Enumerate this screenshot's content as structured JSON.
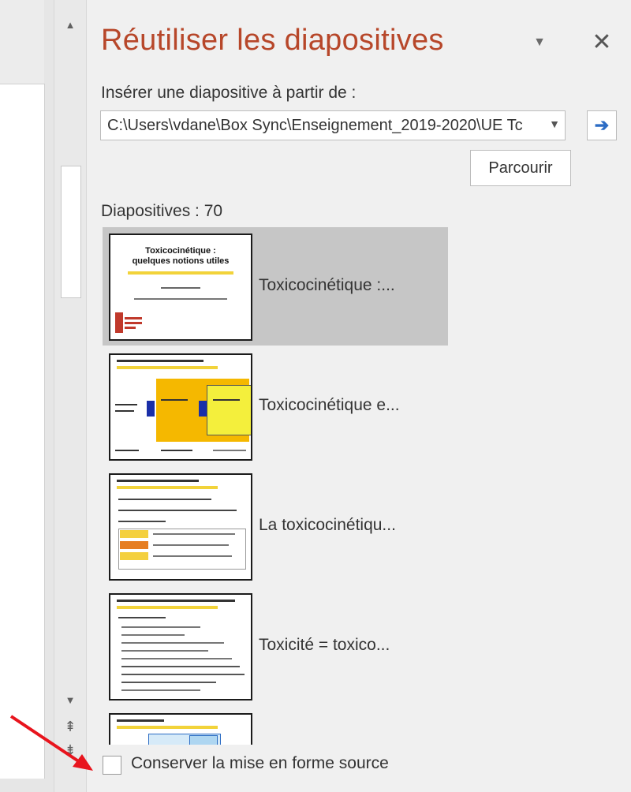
{
  "pane": {
    "title": "Réutiliser les diapositives",
    "insert_label": "Insérer une diapositive à partir de :",
    "path_value": "C:\\Users\\vdane\\Box Sync\\Enseignement_2019-2020\\UE Tc",
    "browse_label": "Parcourir",
    "slides_count": "Diapositives : 70",
    "slides": [
      {
        "label": "Toxicocinétique :...",
        "selected": true
      },
      {
        "label": "Toxicocinétique e..."
      },
      {
        "label": "La toxicocinétiqu..."
      },
      {
        "label": "Toxicité = toxico..."
      }
    ],
    "keep_source_label": "Conserver la mise en forme source"
  },
  "icons": [
    "scroll-up-arrow-icon",
    "scroll-down-arrow-icon",
    "scroll-page-up-icon",
    "scroll-page-down-icon",
    "dropdown-icon",
    "close-icon",
    "go-arrow-icon"
  ],
  "colors": {
    "title": "#b7472a",
    "selected_bg": "#c6c6c6",
    "accent_arrow": "#2b6cc4",
    "annotation_arrow": "#e8141d"
  },
  "slide1_text": {
    "title": "Toxicocinétique :",
    "subtitle": "quelques notions utiles"
  }
}
